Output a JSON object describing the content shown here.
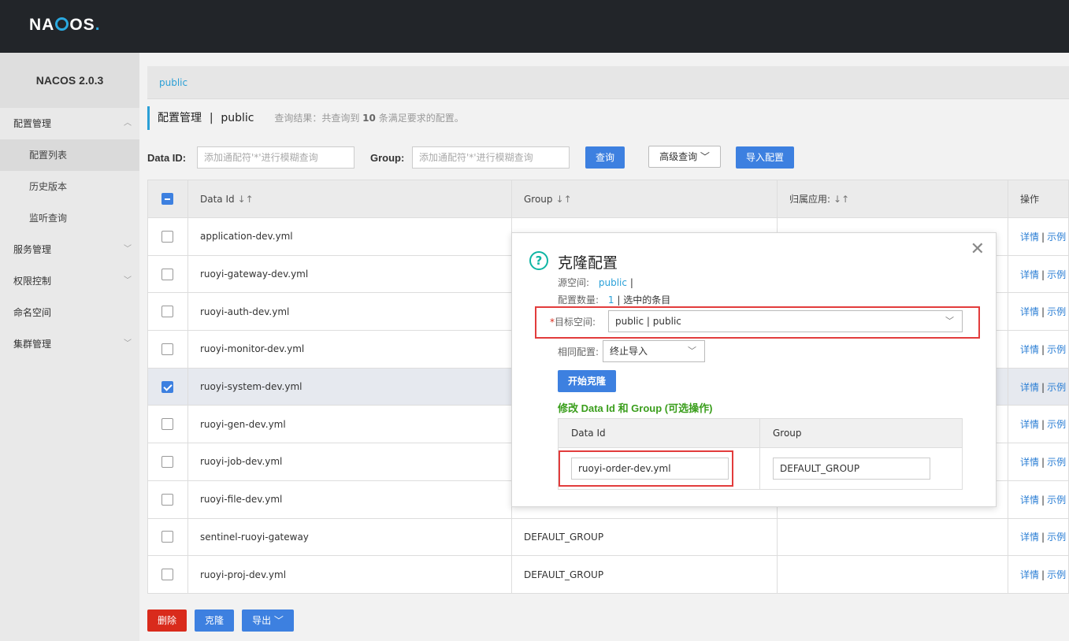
{
  "brand": {
    "logo_text": "NACOS."
  },
  "sidebar": {
    "version": "NACOS 2.0.3",
    "items": [
      {
        "label": "配置管理",
        "expanded": true
      },
      {
        "label": "配置列表"
      },
      {
        "label": "历史版本"
      },
      {
        "label": "监听查询"
      },
      {
        "label": "服务管理"
      },
      {
        "label": "权限控制"
      },
      {
        "label": "命名空间"
      },
      {
        "label": "集群管理"
      }
    ]
  },
  "namespace_bar": {
    "current": "public"
  },
  "page": {
    "title": "配置管理",
    "separator": "|",
    "namespace": "public",
    "hint_prefix": "查询结果：共查询到",
    "hint_count": "10",
    "hint_suffix": "条满足要求的配置。"
  },
  "search": {
    "dataid_label": "Data ID:",
    "dataid_placeholder": "添加通配符'*'进行模糊查询",
    "group_label": "Group:",
    "group_placeholder": "添加通配符'*'进行模糊查询",
    "query_button": "查询",
    "advanced_button": "高级查询",
    "import_button": "导入配置"
  },
  "table": {
    "headers": {
      "data_id": "Data Id",
      "group": "Group",
      "app": "归属应用:",
      "ops": "操作"
    },
    "rows": [
      {
        "data_id": "application-dev.yml",
        "group": "",
        "selected": false
      },
      {
        "data_id": "ruoyi-gateway-dev.yml",
        "group": "",
        "selected": false
      },
      {
        "data_id": "ruoyi-auth-dev.yml",
        "group": "",
        "selected": false
      },
      {
        "data_id": "ruoyi-monitor-dev.yml",
        "group": "",
        "selected": false
      },
      {
        "data_id": "ruoyi-system-dev.yml",
        "group": "",
        "selected": true
      },
      {
        "data_id": "ruoyi-gen-dev.yml",
        "group": "",
        "selected": false
      },
      {
        "data_id": "ruoyi-job-dev.yml",
        "group": "",
        "selected": false
      },
      {
        "data_id": "ruoyi-file-dev.yml",
        "group": "",
        "selected": false
      },
      {
        "data_id": "sentinel-ruoyi-gateway",
        "group": "DEFAULT_GROUP",
        "selected": false
      },
      {
        "data_id": "ruoyi-proj-dev.yml",
        "group": "DEFAULT_GROUP",
        "selected": false
      }
    ],
    "op_detail": "详情",
    "op_sep": "|",
    "op_sample": "示例"
  },
  "bottom": {
    "delete": "删除",
    "clone": "克隆",
    "export": "导出"
  },
  "modal": {
    "title": "克隆配置",
    "source_label": "源空间:",
    "source_value": "public",
    "source_sep": "|",
    "count_label": "配置数量:",
    "count_value": "1",
    "count_suffix": "| 选中的条目",
    "target_required": "*",
    "target_label": "目标空间:",
    "target_value": "public | public",
    "same_label": "相同配置:",
    "same_value": "终止导入",
    "start_button": "开始克隆",
    "modify_title": "修改 Data Id 和 Group (可选操作)",
    "sub_headers": {
      "data_id": "Data Id",
      "group": "Group"
    },
    "sub_row": {
      "data_id": "ruoyi-order-dev.yml",
      "group": "DEFAULT_GROUP"
    }
  },
  "colors": {
    "primary": "#3d80e0",
    "danger": "#d92b1c",
    "highlight": "#e23c3c",
    "accent": "#2a9fd6"
  }
}
